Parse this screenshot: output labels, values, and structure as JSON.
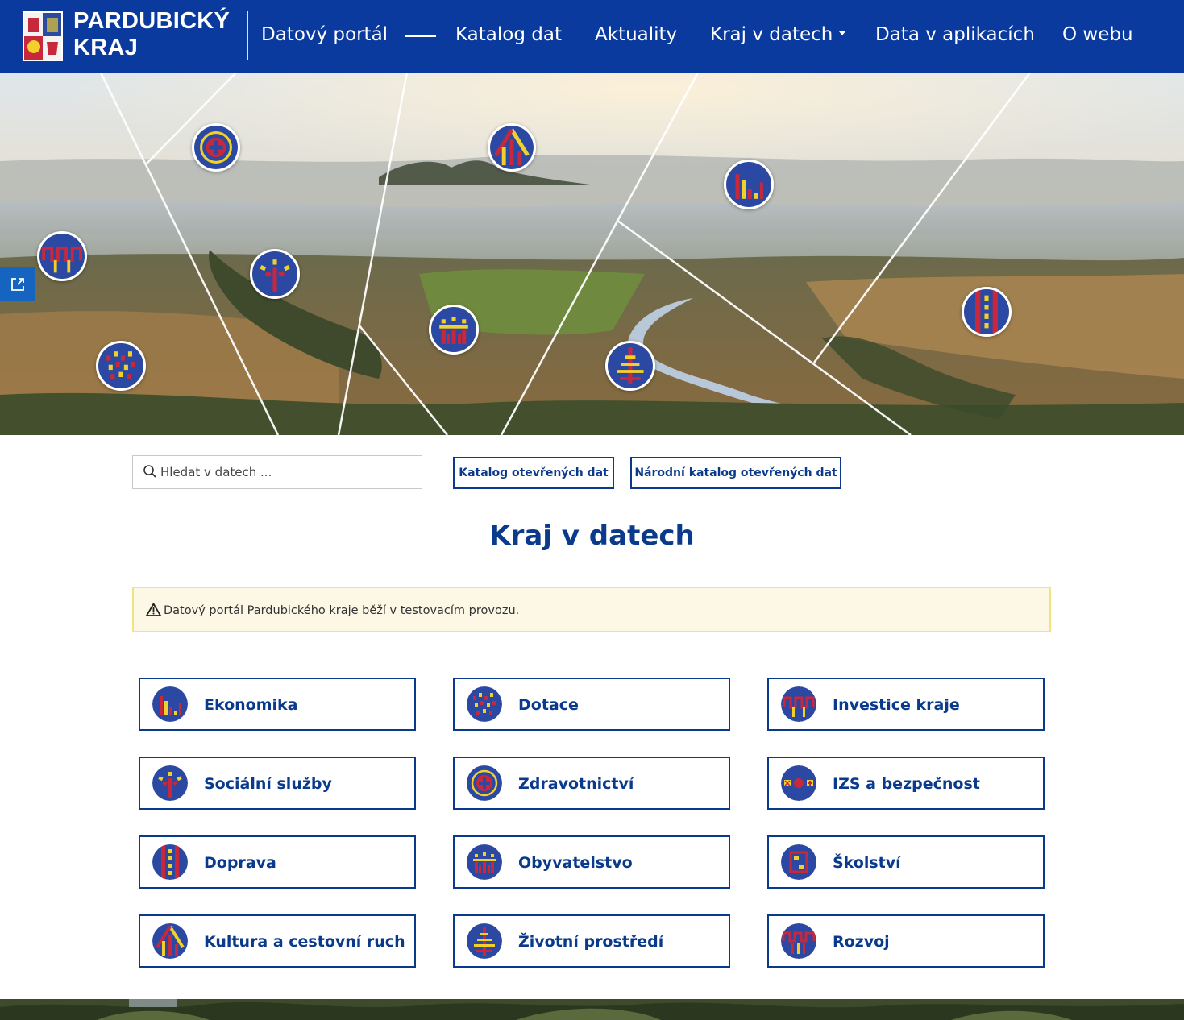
{
  "header": {
    "brand_line1": "PARDUBICKÝ",
    "brand_line2": "KRAJ",
    "nav": [
      {
        "label": "Datový portál"
      },
      {
        "label": "Katalog dat"
      },
      {
        "label": "Aktuality"
      },
      {
        "label": "Kraj v datech",
        "has_dropdown": true
      },
      {
        "label": "Data v aplikacích"
      },
      {
        "label": "O webu"
      }
    ]
  },
  "colors": {
    "header_bg": "#0a3a9e",
    "brand_blue": "#0a3a8c",
    "icon_blue": "#2b48a3",
    "icon_red": "#c8283c",
    "icon_yellow": "#f2d02b",
    "notice_bg": "#fdf8e6",
    "notice_border": "#f3e37c"
  },
  "hero": {
    "share_icon": "share-external-icon"
  },
  "search": {
    "placeholder": "Hledat v datech ..."
  },
  "buttons": {
    "catalog": "Katalog otevřených dat",
    "national_catalog": "Národní katalog otevřených dat"
  },
  "page_title": "Kraj v datech",
  "notice": {
    "text": "Datový portál Pardubického kraje běží v testovacím provozu."
  },
  "categories": [
    {
      "label": "Ekonomika",
      "icon": "bar-chart-icon"
    },
    {
      "label": "Dotace",
      "icon": "dots-pattern-icon"
    },
    {
      "label": "Investice kraje",
      "icon": "meander-icon"
    },
    {
      "label": "Sociální služby",
      "icon": "figure-icon"
    },
    {
      "label": "Zdravotnictví",
      "icon": "medical-cross-icon"
    },
    {
      "label": "IZS a bezpečnost",
      "icon": "emergency-icon"
    },
    {
      "label": "Doprava",
      "icon": "road-lanes-icon"
    },
    {
      "label": "Obyvatelstvo",
      "icon": "people-icon"
    },
    {
      "label": "Školství",
      "icon": "school-icon"
    },
    {
      "label": "Kultura a cestovní ruch",
      "icon": "castle-icon"
    },
    {
      "label": "Životní prostředí",
      "icon": "tree-icon"
    },
    {
      "label": "Rozvoj",
      "icon": "development-icon"
    }
  ]
}
